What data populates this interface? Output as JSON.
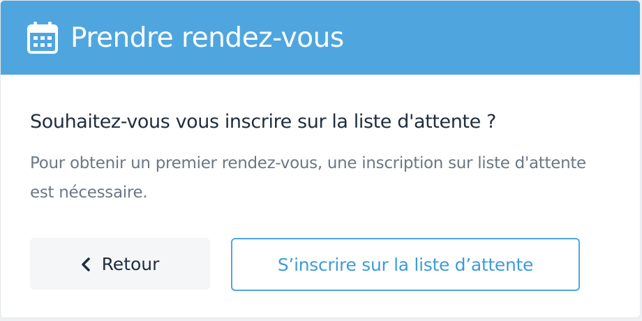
{
  "header": {
    "title": "Prendre rendez-vous",
    "icon": "calendar-icon",
    "background_color": "#4fa6df"
  },
  "body": {
    "question": "Souhaitez-vous vous inscrire sur la liste d'attente ?",
    "description": "Pour obtenir un premier rendez-vous, une inscription sur liste d'attente est nécessaire."
  },
  "actions": {
    "back_label": "Retour",
    "back_icon": "chevron-left-icon",
    "waitlist_label": "S’inscrire sur la liste d’attente",
    "accent_color": "#4fa6df"
  }
}
